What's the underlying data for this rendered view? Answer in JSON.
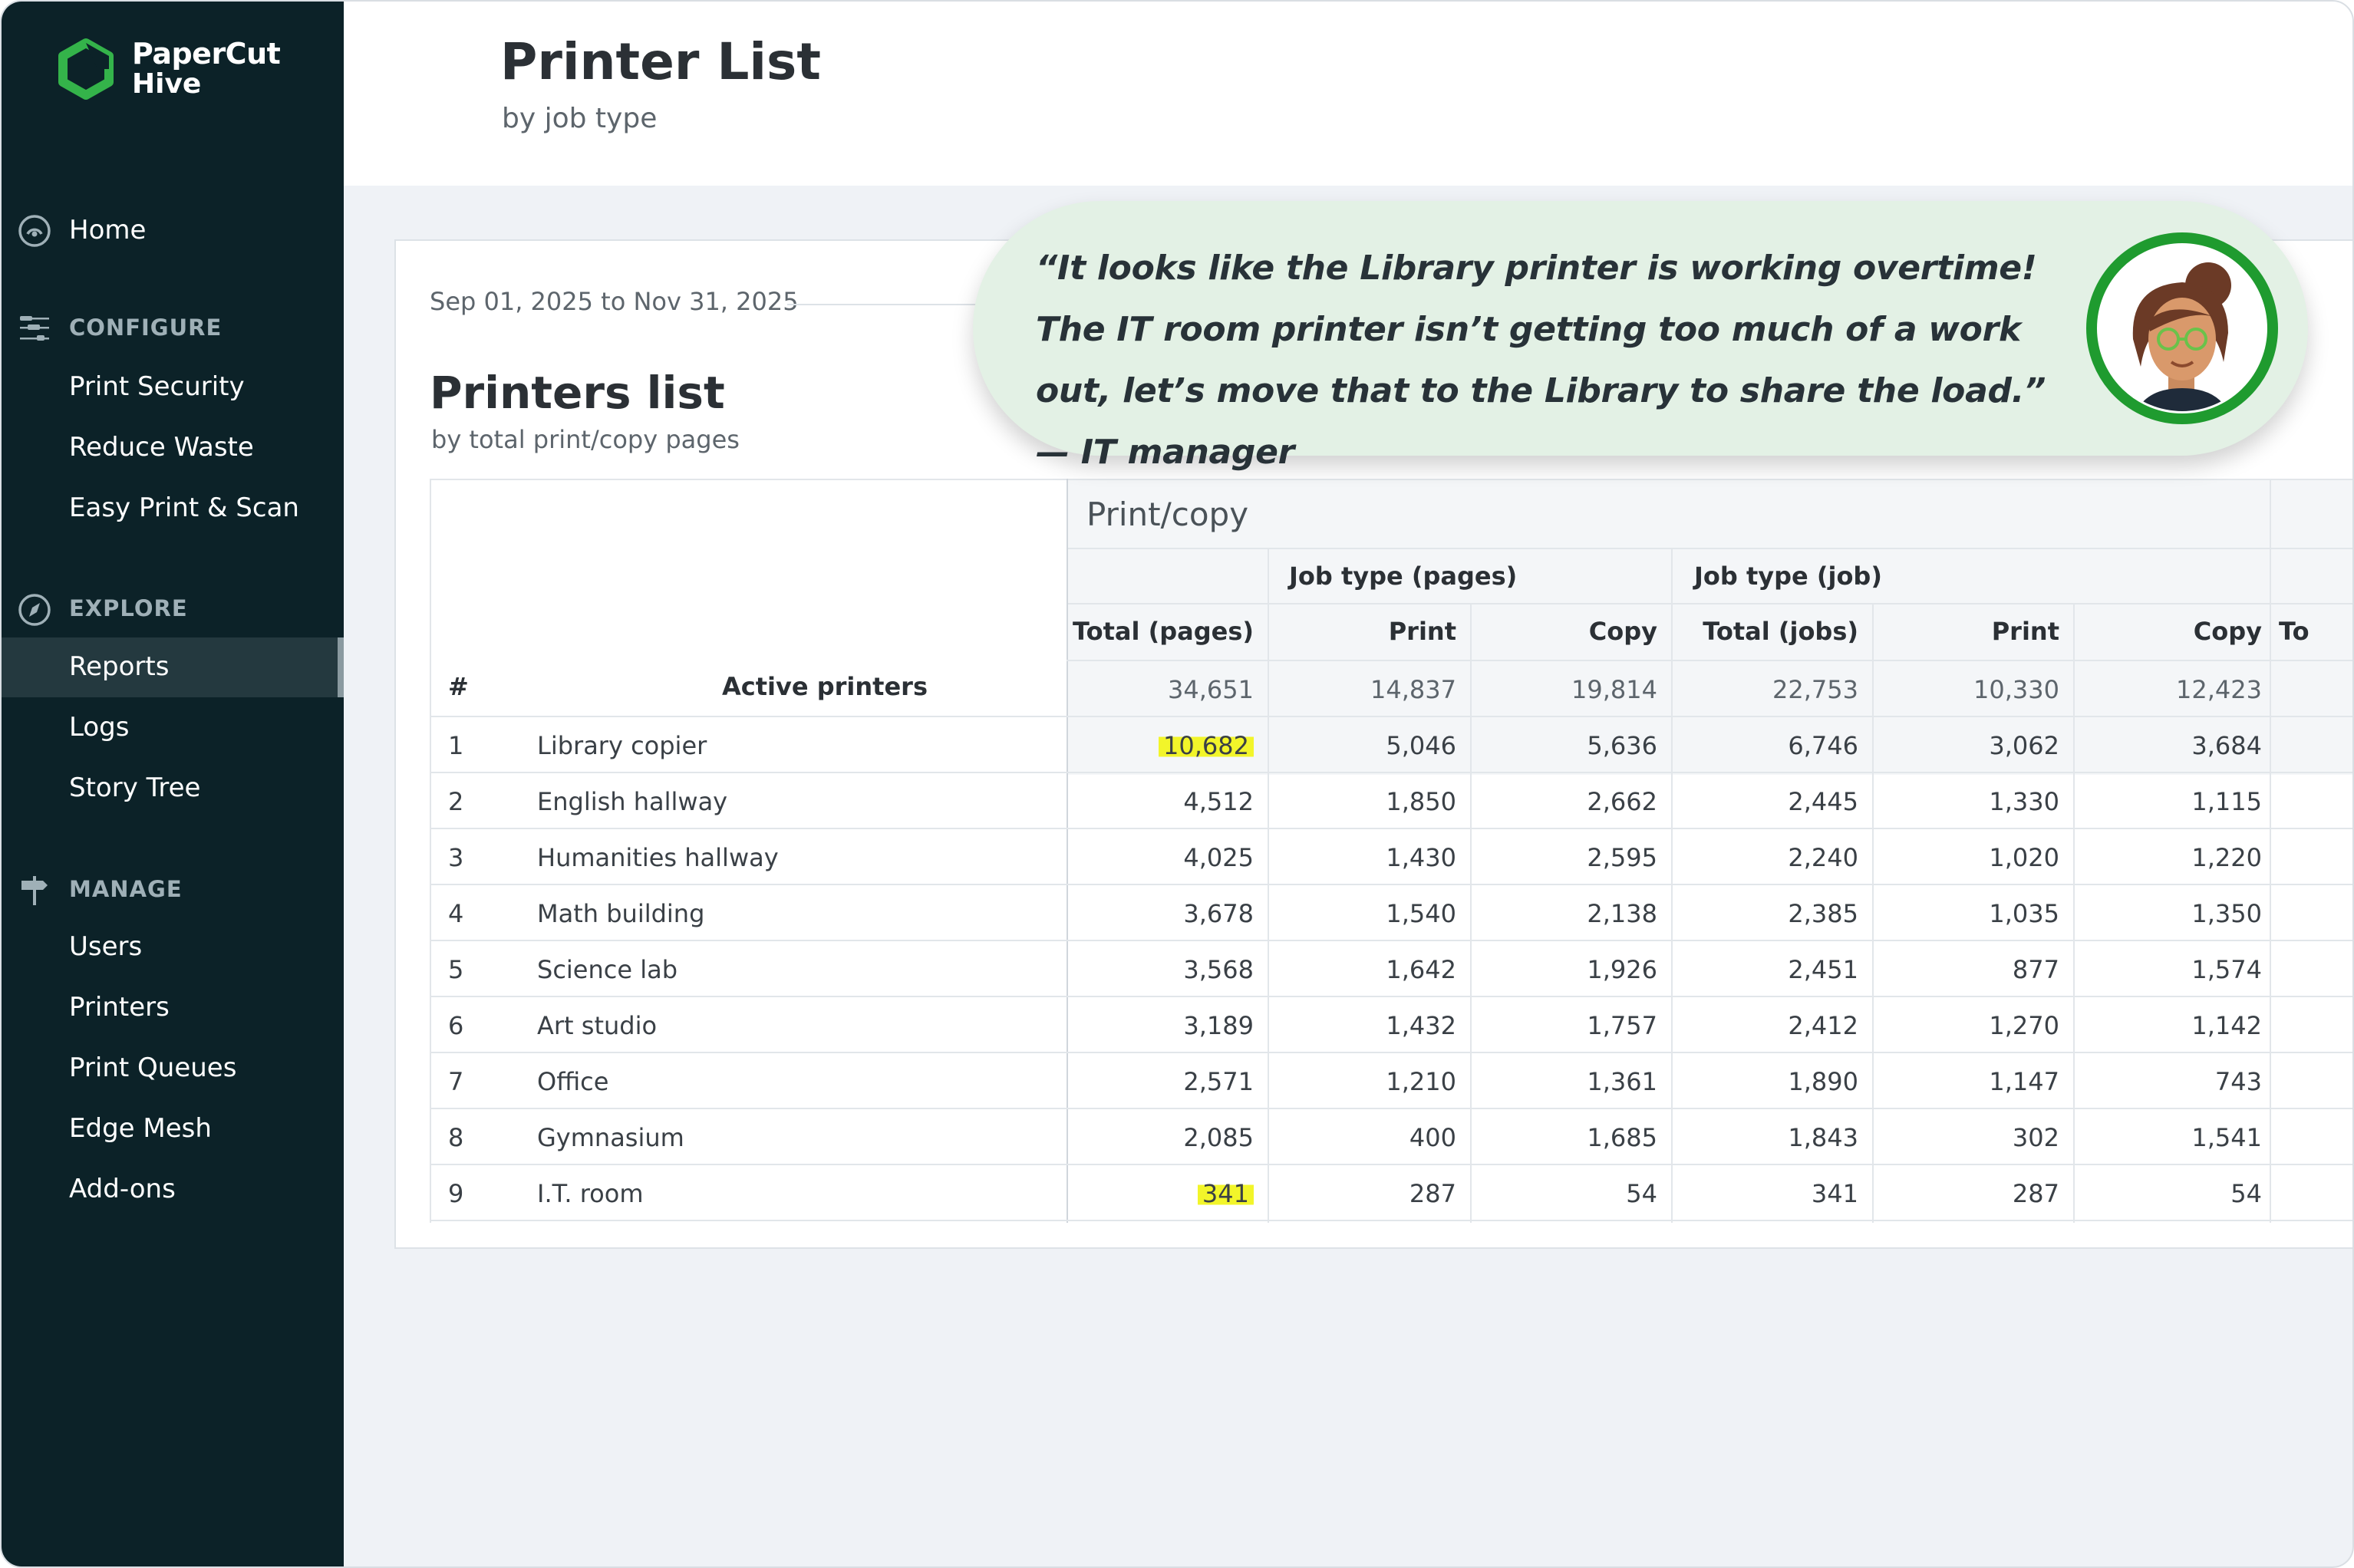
{
  "app": {
    "logo_line1": "PaperCut",
    "logo_line2": "Hive"
  },
  "sidebar": {
    "home": "Home",
    "configure": {
      "label": "CONFIGURE",
      "items": [
        "Print Security",
        "Reduce Waste",
        "Easy Print & Scan"
      ]
    },
    "explore": {
      "label": "EXPLORE",
      "items": [
        "Reports",
        "Logs",
        "Story Tree"
      ],
      "active": "Reports"
    },
    "manage": {
      "label": "MANAGE",
      "items": [
        "Users",
        "Printers",
        "Print Queues",
        "Edge Mesh",
        "Add-ons"
      ]
    }
  },
  "header": {
    "title": "Printer List",
    "subtitle": "by job type"
  },
  "report": {
    "date_range": "Sep 01, 2025 to Nov 31, 2025",
    "title": "Printers list",
    "subtitle": "by total print/copy pages",
    "group_header": "Print/copy",
    "subgroup_pages": "Job type (pages)",
    "subgroup_jobs": "Job type (job)",
    "col_hash": "#",
    "col_printers": "Active printers",
    "columns": [
      "Total (pages)",
      "Print",
      "Copy",
      "Total (jobs)",
      "Print",
      "Copy",
      "To"
    ],
    "totals": [
      "34,651",
      "14,837",
      "19,814",
      "22,753",
      "10,330",
      "12,423"
    ],
    "rows": [
      {
        "num": "1",
        "name": "Library copier",
        "values": [
          "10,682",
          "5,046",
          "5,636",
          "6,746",
          "3,062",
          "3,684"
        ]
      },
      {
        "num": "2",
        "name": "English hallway",
        "values": [
          "4,512",
          "1,850",
          "2,662",
          "2,445",
          "1,330",
          "1,115"
        ]
      },
      {
        "num": "3",
        "name": "Humanities hallway",
        "values": [
          "4,025",
          "1,430",
          "2,595",
          "2,240",
          "1,020",
          "1,220"
        ]
      },
      {
        "num": "4",
        "name": "Math building",
        "values": [
          "3,678",
          "1,540",
          "2,138",
          "2,385",
          "1,035",
          "1,350"
        ]
      },
      {
        "num": "5",
        "name": "Science lab",
        "values": [
          "3,568",
          "1,642",
          "1,926",
          "2,451",
          "877",
          "1,574"
        ]
      },
      {
        "num": "6",
        "name": "Art studio",
        "values": [
          "3,189",
          "1,432",
          "1,757",
          "2,412",
          "1,270",
          "1,142"
        ]
      },
      {
        "num": "7",
        "name": "Office",
        "values": [
          "2,571",
          "1,210",
          "1,361",
          "1,890",
          "1,147",
          "743"
        ]
      },
      {
        "num": "8",
        "name": "Gymnasium",
        "values": [
          "2,085",
          "400",
          "1,685",
          "1,843",
          "302",
          "1,541"
        ]
      },
      {
        "num": "9",
        "name": "I.T. room",
        "values": [
          "341",
          "287",
          "54",
          "341",
          "287",
          "54"
        ]
      }
    ],
    "highlighted_rows": [
      "1",
      "9"
    ]
  },
  "quote": {
    "text": "“It looks like the Library printer is working overtime! The IT room printer isn’t getting too much of a work out, let’s move that to the Library to share the load.” — IT manager"
  },
  "colors": {
    "sidebar_bg": "#0c2228",
    "brand_green": "#27a33a",
    "highlight": "#f2f52a",
    "quote_bg": "#e3f1e5"
  }
}
